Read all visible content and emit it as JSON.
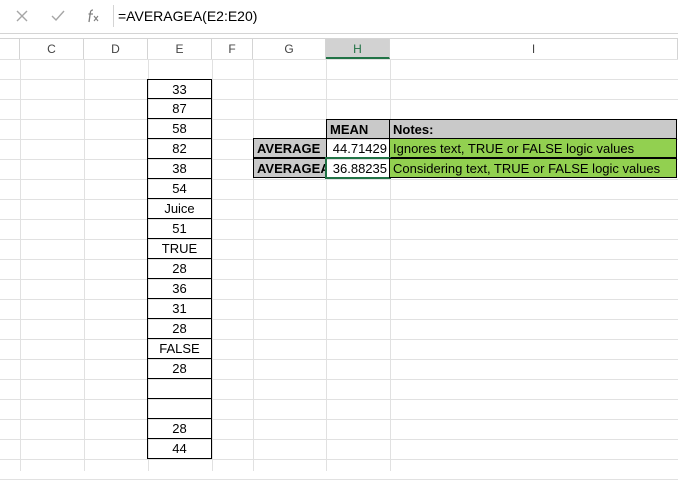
{
  "formula_bar": {
    "cancel_icon": "close-icon",
    "enter_icon": "check-icon",
    "function_icon": "fx-icon",
    "formula": "=AVERAGEA(E2:E20)"
  },
  "columns": [
    "C",
    "D",
    "E",
    "F",
    "G",
    "H",
    "I"
  ],
  "selected_column": "H",
  "column_e_values": [
    "33",
    "87",
    "58",
    "82",
    "38",
    "54",
    "Juice",
    "51",
    "TRUE",
    "28",
    "36",
    "31",
    "28",
    "FALSE",
    "28",
    "",
    "",
    "28",
    "44"
  ],
  "table": {
    "mean_header": "MEAN",
    "notes_header": "Notes:",
    "rows": [
      {
        "label": "AVERAGE",
        "value": "44.71429",
        "note": "Ignores text, TRUE or FALSE logic values"
      },
      {
        "label": "AVERAGEA",
        "value": "36.88235",
        "note": "Considering text, TRUE or FALSE logic values"
      }
    ]
  },
  "colors": {
    "header_gray": "#c9c9c9",
    "note_green": "#92d050",
    "selection_green": "#217346"
  }
}
